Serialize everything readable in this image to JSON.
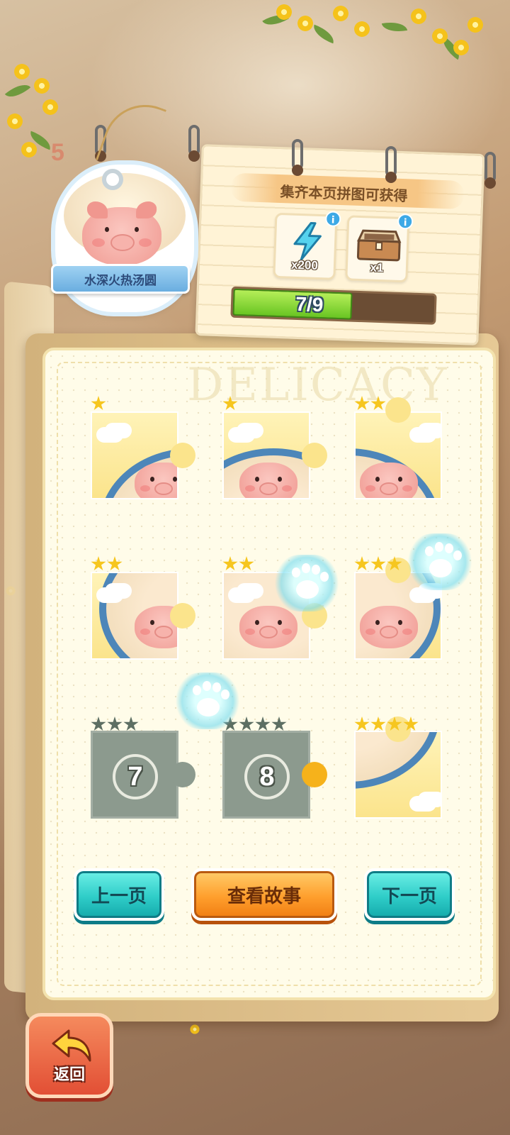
{
  "page_number": "5",
  "album": {
    "tag_label": "水深火热汤圆",
    "watermark": "DELICACY"
  },
  "reward_card": {
    "title": "集齐本页拼图可获得",
    "rewards": [
      {
        "icon": "lightning-energy-icon",
        "quantity": "x200"
      },
      {
        "icon": "treasure-chest-icon",
        "quantity": "x1"
      }
    ],
    "progress_text": "7/9",
    "progress_fraction": 0.777
  },
  "puzzle": {
    "pieces": [
      {
        "id": 1,
        "stars": 1,
        "max_stars": 1,
        "collected": true
      },
      {
        "id": 2,
        "stars": 1,
        "max_stars": 1,
        "collected": true
      },
      {
        "id": 3,
        "stars": 2,
        "max_stars": 2,
        "collected": true
      },
      {
        "id": 4,
        "stars": 2,
        "max_stars": 2,
        "collected": true
      },
      {
        "id": 5,
        "stars": 2,
        "max_stars": 2,
        "collected": true
      },
      {
        "id": 6,
        "stars": 3,
        "max_stars": 3,
        "collected": true
      },
      {
        "id": 7,
        "stars": 0,
        "max_stars": 3,
        "collected": false,
        "label": "7"
      },
      {
        "id": 8,
        "stars": 0,
        "max_stars": 4,
        "collected": false,
        "label": "8",
        "selected": true
      },
      {
        "id": 9,
        "stars": 4,
        "max_stars": 4,
        "collected": true
      }
    ]
  },
  "buttons": {
    "prev_page": "上一页",
    "view_story": "查看故事",
    "next_page": "下一页",
    "back": "返回"
  },
  "colors": {
    "teal_button": "#2fcdc8",
    "orange_button": "#ff9f2d",
    "back_button": "#e24f35",
    "progress_fill": "#69c523",
    "star_gold": "#f6c61f",
    "locked_piece": "#8c9a8e"
  }
}
